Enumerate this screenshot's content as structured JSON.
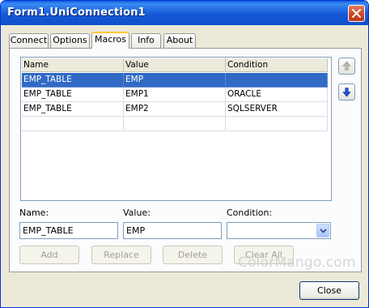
{
  "window": {
    "title": "Form1.UniConnection1"
  },
  "tabs": [
    {
      "label": "Connect",
      "active": false
    },
    {
      "label": "Options",
      "active": false
    },
    {
      "label": "Macros",
      "active": true
    },
    {
      "label": "Info",
      "active": false
    },
    {
      "label": "About",
      "active": false
    }
  ],
  "grid": {
    "columns": [
      "Name",
      "Value",
      "Condition"
    ],
    "rows": [
      [
        "EMP_TABLE",
        "EMP",
        ""
      ],
      [
        "EMP_TABLE",
        "EMP1",
        "ORACLE"
      ],
      [
        "EMP_TABLE",
        "EMP2",
        "SQLSERVER"
      ],
      [
        "",
        "",
        ""
      ]
    ],
    "selected_row": 0
  },
  "side_buttons": {
    "up_icon": "arrow-up-icon",
    "down_icon": "arrow-down-icon"
  },
  "form": {
    "name_label": "Name:",
    "name_value": "EMP_TABLE",
    "value_label": "Value:",
    "value_value": "EMP",
    "condition_label": "Condition:",
    "condition_value": ""
  },
  "buttons": {
    "add": "Add",
    "replace": "Replace",
    "delete": "Delete",
    "clear_all": "Clear All",
    "close": "Close"
  },
  "watermark": "ColorMango.com"
}
